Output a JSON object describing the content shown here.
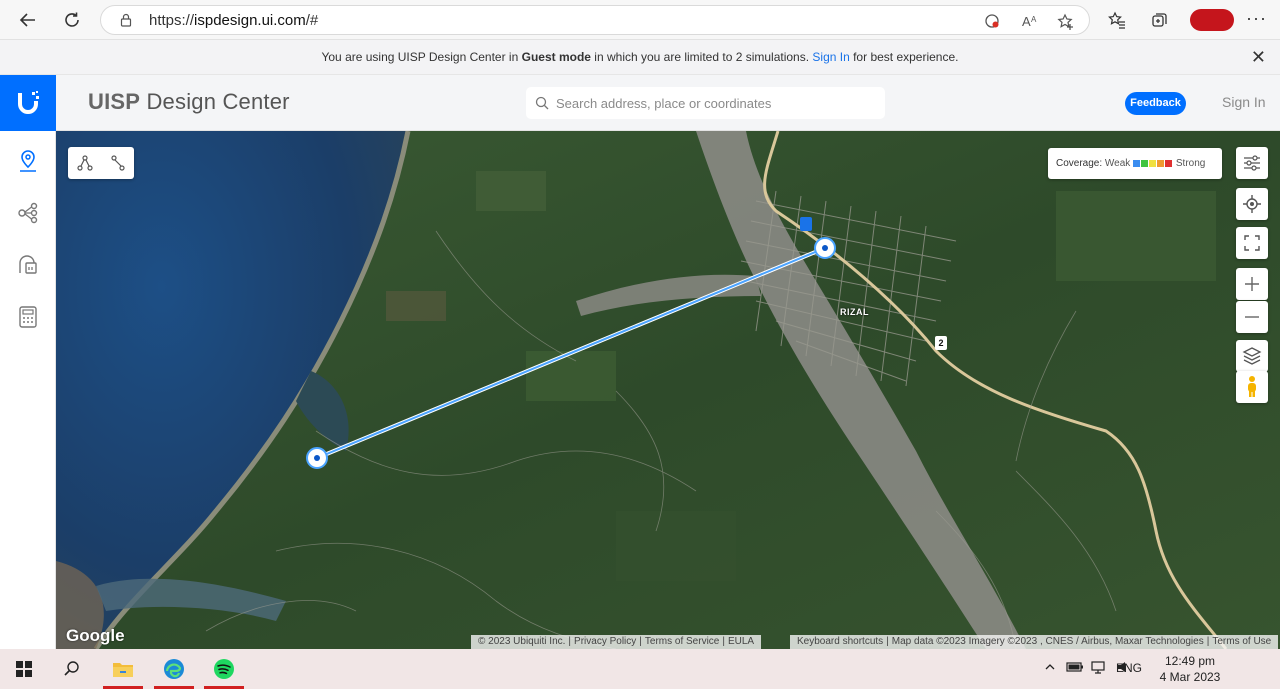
{
  "browser": {
    "url_scheme": "https://",
    "url_host": "ispdesign.ui.com",
    "url_path": "/#"
  },
  "banner": {
    "prefix": "You are using UISP Design Center in ",
    "mode": "Guest mode",
    "middle": " in which you are limited to 2 simulations. ",
    "sign_in_link": "Sign In",
    "suffix": " for best experience."
  },
  "header": {
    "brand_strong": "UISP",
    "brand_rest": " Design Center",
    "search_placeholder": "Search address, place or coordinates",
    "feedback_label": "Feedback",
    "sign_in_label": "Sign In"
  },
  "sidebar": {
    "items": [
      {
        "icon": "map-pin-icon",
        "active": true
      },
      {
        "icon": "topology-icon",
        "active": false
      },
      {
        "icon": "antenna-device-icon",
        "active": false
      },
      {
        "icon": "calculator-icon",
        "active": false
      }
    ]
  },
  "map": {
    "coverage_label": "Coverage:",
    "coverage_weak": "Weak",
    "coverage_strong": "Strong",
    "coverage_colors": [
      "#3b8df0",
      "#3fc43f",
      "#f0e040",
      "#f09a30",
      "#e03030"
    ],
    "place_label": "RIZAL",
    "route_number": "2",
    "google_logo": "Google",
    "attributions": [
      "© 2023 Ubiquiti Inc.",
      "Privacy Policy",
      "Terms of Service",
      "EULA"
    ],
    "attributions_right": [
      "Keyboard shortcuts",
      "Map data ©2023 Imagery ©2023 , CNES / Airbus, Maxar Technologies",
      "Terms of Use"
    ],
    "link_color": "#4aa3ff"
  },
  "taskbar": {
    "language": "ENG",
    "time": "12:49 pm",
    "date": "4 Mar 2023"
  }
}
